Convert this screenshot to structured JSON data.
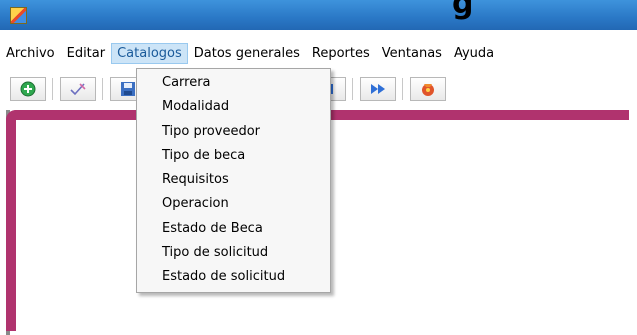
{
  "titlebar": {
    "title_fragment": "g"
  },
  "menubar": {
    "items": [
      {
        "label": "Archivo"
      },
      {
        "label": "Editar"
      },
      {
        "label": "Catalogos"
      },
      {
        "label": "Datos generales"
      },
      {
        "label": "Reportes"
      },
      {
        "label": "Ventanas"
      },
      {
        "label": "Ayuda"
      }
    ],
    "active_index": 2
  },
  "toolbar": {
    "buttons": [
      {
        "icon": "add-icon"
      },
      {
        "icon": "edit-icon"
      },
      {
        "icon": "save-icon"
      },
      {
        "icon": "last-record-icon"
      },
      {
        "icon": "next-fast-icon"
      },
      {
        "icon": "delete-icon"
      }
    ]
  },
  "dropdown": {
    "items": [
      {
        "label": "Carrera"
      },
      {
        "label": "Modalidad"
      },
      {
        "label": "Tipo proveedor"
      },
      {
        "label": "Tipo de beca"
      },
      {
        "label": "Requisitos"
      },
      {
        "label": "Operacion"
      },
      {
        "label": "Estado de Beca"
      },
      {
        "label": "Tipo de solicitud"
      },
      {
        "label": "Estado de solicitud"
      }
    ]
  },
  "colors": {
    "titlebar": "#2a78c6",
    "menu_highlight": "#cce4f7",
    "mdi_frame": "#b0336e"
  }
}
